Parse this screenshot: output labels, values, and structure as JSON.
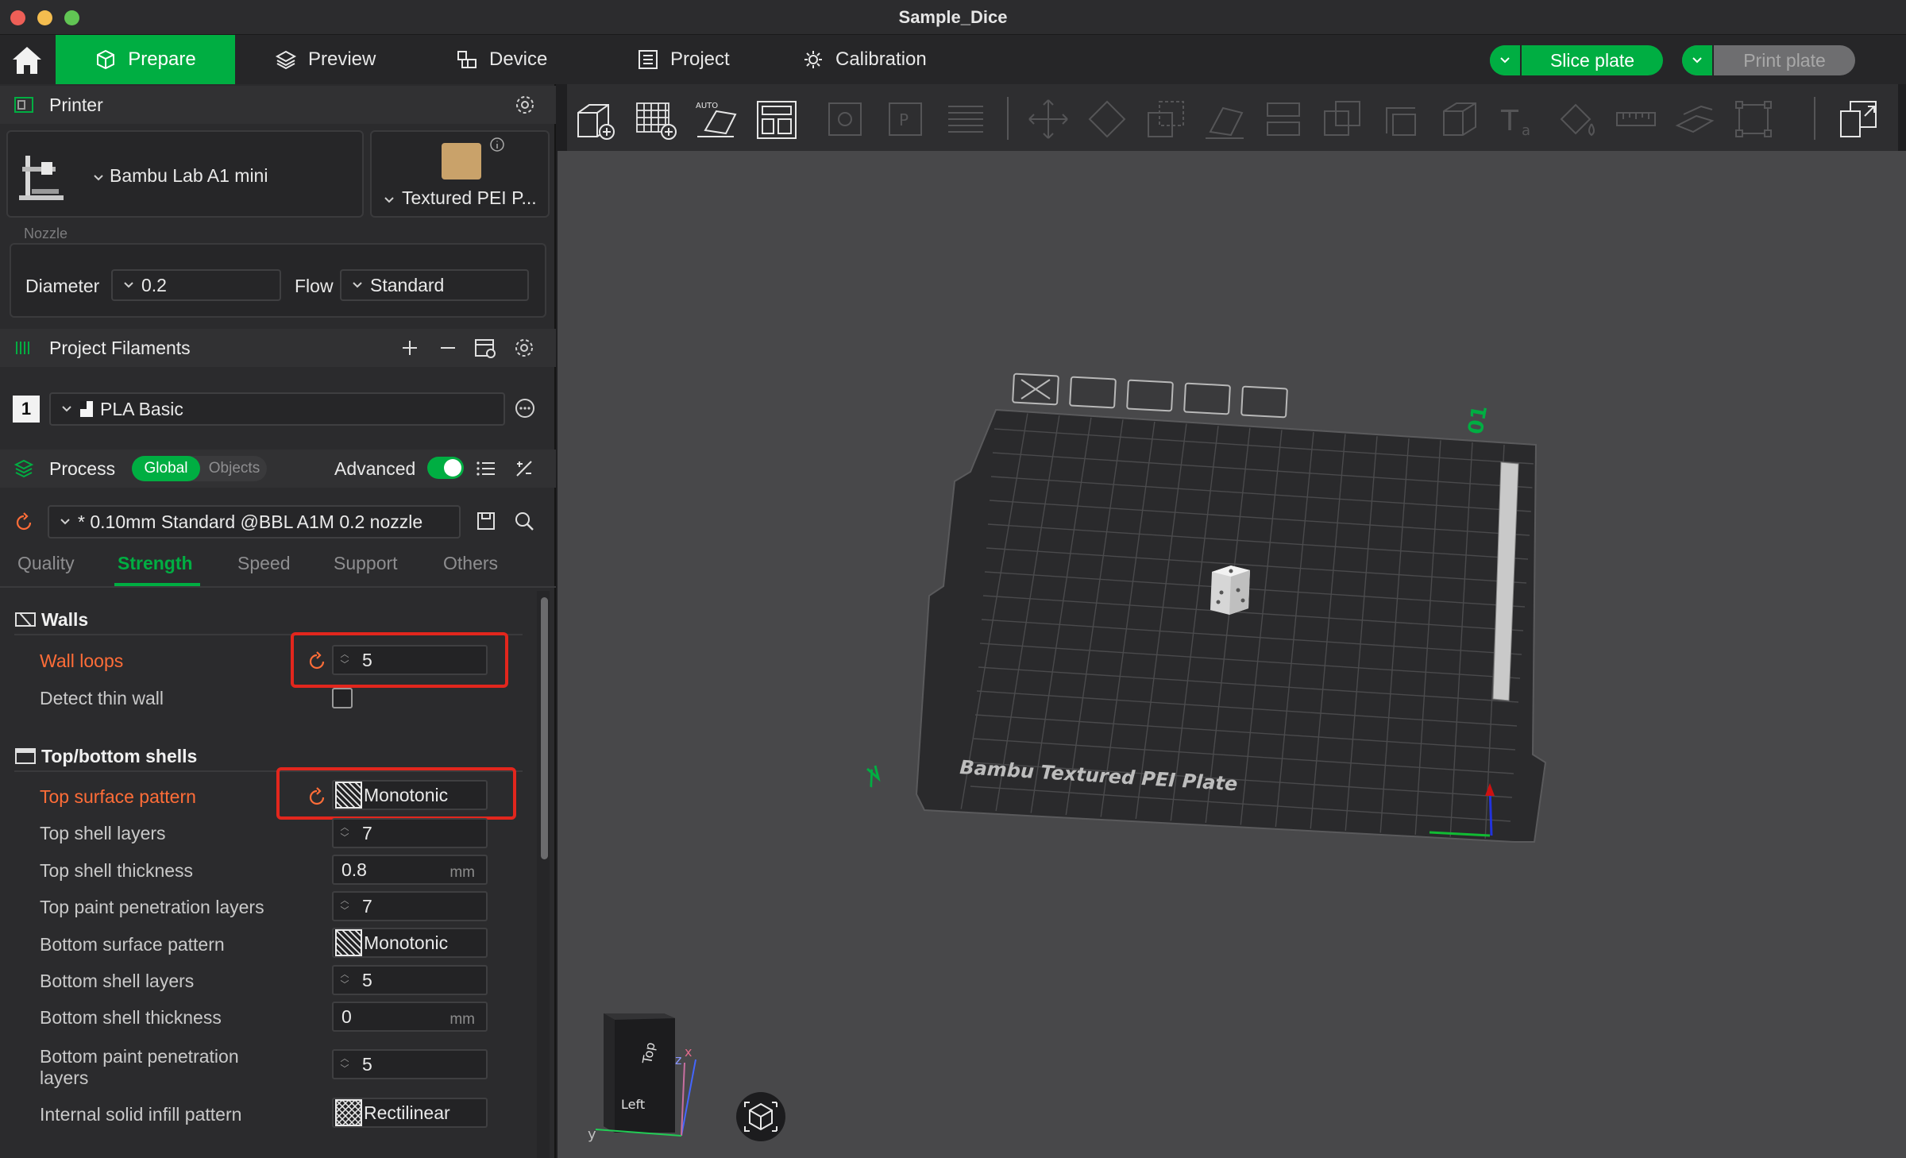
{
  "window": {
    "title": "Sample_Dice"
  },
  "nav": {
    "tabs": [
      {
        "label": "Prepare",
        "icon": "cube-icon"
      },
      {
        "label": "Preview",
        "icon": "layers-icon"
      },
      {
        "label": "Device",
        "icon": "device-icon"
      },
      {
        "label": "Project",
        "icon": "project-icon"
      },
      {
        "label": "Calibration",
        "icon": "calibration-icon"
      }
    ],
    "slice_label": "Slice plate",
    "print_label": "Print plate",
    "accent": "#00ae42"
  },
  "printer": {
    "header": "Printer",
    "name": "Bambu Lab A1 mini",
    "plate": "Textured PEI P...",
    "nozzle_label": "Nozzle",
    "diameter_label": "Diameter",
    "diameter_value": "0.2",
    "flow_label": "Flow",
    "flow_value": "Standard"
  },
  "filaments": {
    "header": "Project Filaments",
    "items": [
      {
        "index": "1",
        "name": "PLA Basic"
      }
    ]
  },
  "process": {
    "header": "Process",
    "global_label": "Global",
    "objects_label": "Objects",
    "advanced_label": "Advanced",
    "advanced_on": true,
    "preset": "* 0.10mm Standard @BBL A1M 0.2 nozzle",
    "tabs": [
      "Quality",
      "Strength",
      "Speed",
      "Support",
      "Others"
    ],
    "active_tab": "Strength"
  },
  "walls": {
    "title": "Walls",
    "wall_loops_label": "Wall loops",
    "wall_loops_value": "5",
    "detect_thin_wall_label": "Detect thin wall"
  },
  "shells": {
    "title": "Top/bottom shells",
    "top_surface_pattern_label": "Top surface pattern",
    "top_surface_pattern_value": "Monotonic",
    "top_shell_layers_label": "Top shell layers",
    "top_shell_layers_value": "7",
    "top_shell_thickness_label": "Top shell thickness",
    "top_shell_thickness_value": "0.8",
    "top_paint_label": "Top paint penetration layers",
    "top_paint_value": "7",
    "bottom_surface_pattern_label": "Bottom surface pattern",
    "bottom_surface_pattern_value": "Monotonic",
    "bottom_shell_layers_label": "Bottom shell layers",
    "bottom_shell_layers_value": "5",
    "bottom_shell_thickness_label": "Bottom shell thickness",
    "bottom_shell_thickness_value": "0",
    "bottom_paint_label_1": "Bottom paint penetration",
    "bottom_paint_label_2": "layers",
    "bottom_paint_value": "5",
    "internal_infill_label": "Internal solid infill pattern",
    "internal_infill_value": "Rectilinear",
    "unit_mm": "mm"
  },
  "scene": {
    "plate_label": "Bambu Textured PEI Plate",
    "plate_number": "01",
    "cube_top": "Top",
    "cube_left": "Left",
    "axis_y": "y",
    "axis_x": "x",
    "axis_z": "z"
  }
}
